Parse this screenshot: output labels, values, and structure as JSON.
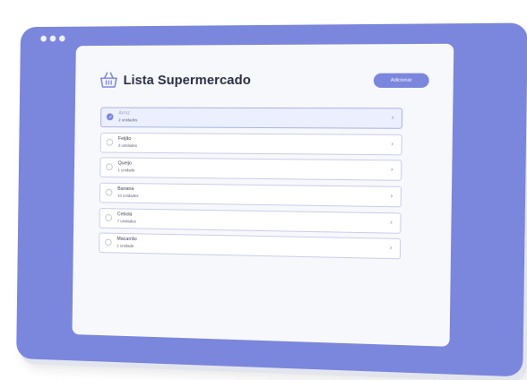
{
  "app": {
    "title": "Lista Supermercado"
  },
  "header": {
    "add_label": "Adicionar"
  },
  "items": [
    {
      "name": "Arroz",
      "qty": "2 unidades",
      "checked": true
    },
    {
      "name": "Feijão",
      "qty": "3 unidades",
      "checked": false
    },
    {
      "name": "Queijo",
      "qty": "1 unidade",
      "checked": false
    },
    {
      "name": "Banana",
      "qty": "10 unidades",
      "checked": false
    },
    {
      "name": "Cebola",
      "qty": "7 unidades",
      "checked": false
    },
    {
      "name": "Macarrão",
      "qty": "1 unidade",
      "checked": false
    }
  ],
  "colors": {
    "accent": "#7b86dd",
    "surface": "#f7f8fb",
    "text": "#2b2f45"
  },
  "icons": {
    "logo": "basket-icon",
    "row_action": "chevron-right-icon",
    "checked": "check-icon"
  }
}
